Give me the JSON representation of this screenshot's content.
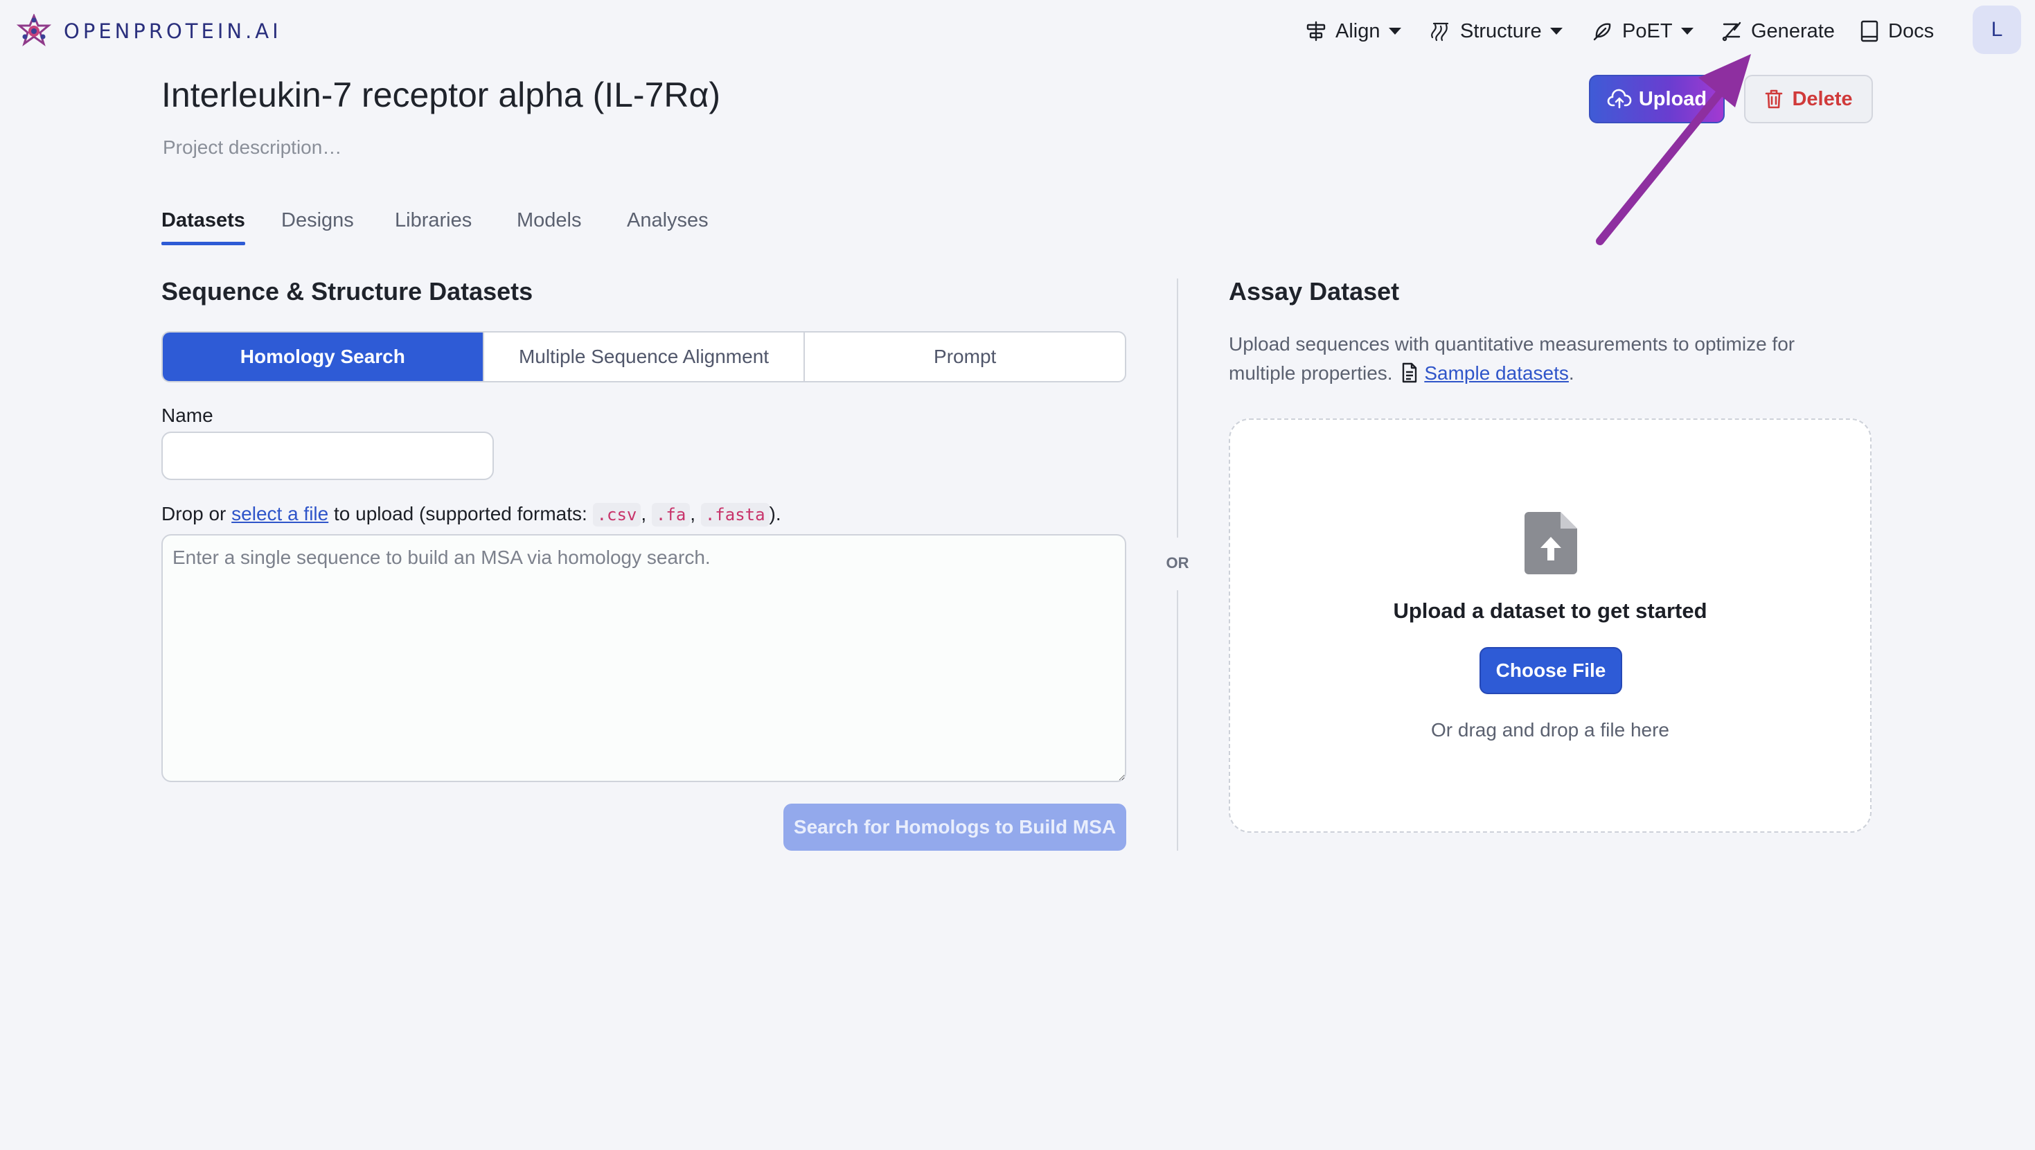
{
  "brand": {
    "name": "OPENPROTEIN.AI"
  },
  "nav": {
    "align": "Align",
    "structure": "Structure",
    "poet": "PoET",
    "generate": "Generate",
    "docs": "Docs",
    "avatar_initial": "L"
  },
  "project": {
    "title": "Interleukin-7 receptor alpha (IL-7Rα)",
    "description": "Project description…"
  },
  "actions": {
    "upload": "Upload",
    "delete": "Delete"
  },
  "tabs": [
    "Datasets",
    "Designs",
    "Libraries",
    "Models",
    "Analyses"
  ],
  "left": {
    "title": "Sequence & Structure Datasets",
    "modes": [
      "Homology Search",
      "Multiple Sequence Alignment",
      "Prompt"
    ],
    "name_label": "Name",
    "drop_prefix": "Drop or",
    "select_link": "select a file",
    "drop_middle": "to upload (supported formats:",
    "formats": [
      ".csv",
      ".fa",
      ".fasta"
    ],
    "drop_suffix": ").",
    "sequence_placeholder": "Enter a single sequence to build an MSA via homology search.",
    "search_button": "Search for Homologs to Build MSA"
  },
  "divider": {
    "or": "OR"
  },
  "right": {
    "title": "Assay Dataset",
    "desc": "Upload sequences with quantitative measurements to optimize for multiple properties.",
    "sample_link": "Sample datasets",
    "desc_end": ".",
    "dropzone_title": "Upload a dataset to get started",
    "choose_button": "Choose File",
    "drag_hint": "Or drag and drop a file here"
  },
  "colors": {
    "accent": "#2e5bd6",
    "annotation_arrow": "#8e2fa0",
    "delete": "#d03a3a",
    "brand": "#2a2f7d"
  }
}
